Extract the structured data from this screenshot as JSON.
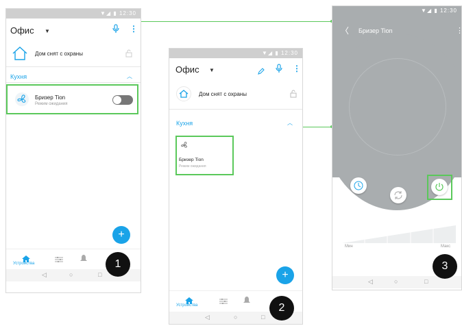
{
  "colors": {
    "accent": "#1aa3e8",
    "highlight": "#5ac85a",
    "status_bar": "#cfcfcf",
    "breezer_bg": "#a9adaf"
  },
  "status": {
    "time": "12:30"
  },
  "screen1": {
    "location": "Офис",
    "security_text": "Дом снят с охраны",
    "section": "Кухня",
    "device_name": "Бризер Tion",
    "device_status": "Режим ожидания",
    "tab_label": "Устройства",
    "badge": "1"
  },
  "screen2": {
    "location": "Офис",
    "security_text": "Дом снят с охраны",
    "section": "Кухня",
    "device_name": "Бризер Tion",
    "device_status": "Режим ожидания",
    "tab_label": "Устройства",
    "badge": "2"
  },
  "screen3": {
    "title": "Бризер Tion",
    "min_label": "Мин",
    "max_label": "Макс",
    "badge": "3"
  },
  "icons": {
    "back": "back-arrow-icon",
    "power": "power-icon",
    "timer": "clock-icon",
    "recycle": "recirculation-icon",
    "fan": "fan-icon",
    "home": "home-icon",
    "lock": "lock-icon",
    "mic": "mic-icon",
    "pencil": "pencil-icon",
    "bell": "bell-icon",
    "sliders": "sliders-icon"
  }
}
